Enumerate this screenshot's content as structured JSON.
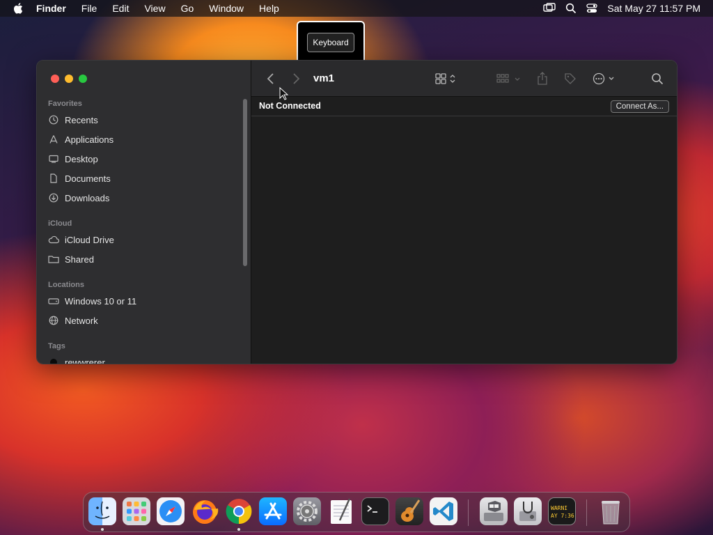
{
  "menubar": {
    "app": "Finder",
    "items": [
      "File",
      "Edit",
      "View",
      "Go",
      "Window",
      "Help"
    ],
    "clock": "Sat May 27  11:57 PM"
  },
  "tooltip": {
    "label": "Keyboard"
  },
  "window": {
    "title": "vm1",
    "status": "Not Connected",
    "connect_button": "Connect As..."
  },
  "sidebar": {
    "favorites_heading": "Favorites",
    "favorites": [
      "Recents",
      "Applications",
      "Desktop",
      "Documents",
      "Downloads"
    ],
    "icloud_heading": "iCloud",
    "icloud": [
      "iCloud Drive",
      "Shared"
    ],
    "locations_heading": "Locations",
    "locations": [
      "Windows 10 or 11",
      "Network"
    ],
    "tags_heading": "Tags",
    "tags": [
      "rewwrerer"
    ]
  },
  "dock": {
    "apps": [
      "finder-icon",
      "launchpad-icon",
      "safari-icon",
      "firefox-icon",
      "chrome-icon",
      "app-store-icon",
      "system-settings-icon",
      "textedit-icon",
      "terminal-icon",
      "garageband-icon",
      "vscode-icon",
      "boot-camp-icon",
      "disk-utility-icon",
      "console-icon",
      "trash-icon"
    ],
    "console_text": "WARNI\nAY 7:36"
  }
}
